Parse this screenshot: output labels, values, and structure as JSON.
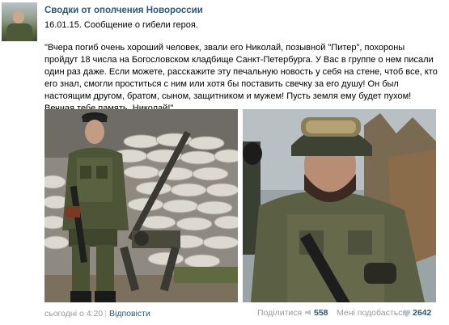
{
  "post": {
    "author": "Сводки от ополчения Новороссии",
    "subtitle": "16.01.15. Сообщение о гибели героя.",
    "text": "\"Вчера погиб очень хороший человек, звали его Николай, позывной \"Питер\", похороны пройдут 18 числа на Богословском кладбище Санкт-Петербурга. У Вас в группе о нем писали один раз даже. Если можете, расскажите эту печальную новость у себя на стене, чтоб все, кто его знал, смогли проститься с ним или хотя бы поставить свечку за его душу! Он был настоящим другом, братом, сыном, защитником и мужем! Пусть земля ему будет пухом! Вечная тебе память, Николай!\"",
    "photos": [
      {
        "icon": "soldier-with-machine-gun-photo"
      },
      {
        "icon": "soldier-portrait-photo"
      }
    ]
  },
  "footer": {
    "time": "сьогодні о 4:20",
    "separator": "|",
    "reply_label": "Відповісти",
    "share_label": "Поділитися",
    "share_count": "558",
    "like_label": "Мені подобається",
    "like_count": "2642"
  },
  "colors": {
    "link": "#2b587a",
    "muted": "#999999",
    "heart": "#b9c4d3"
  }
}
